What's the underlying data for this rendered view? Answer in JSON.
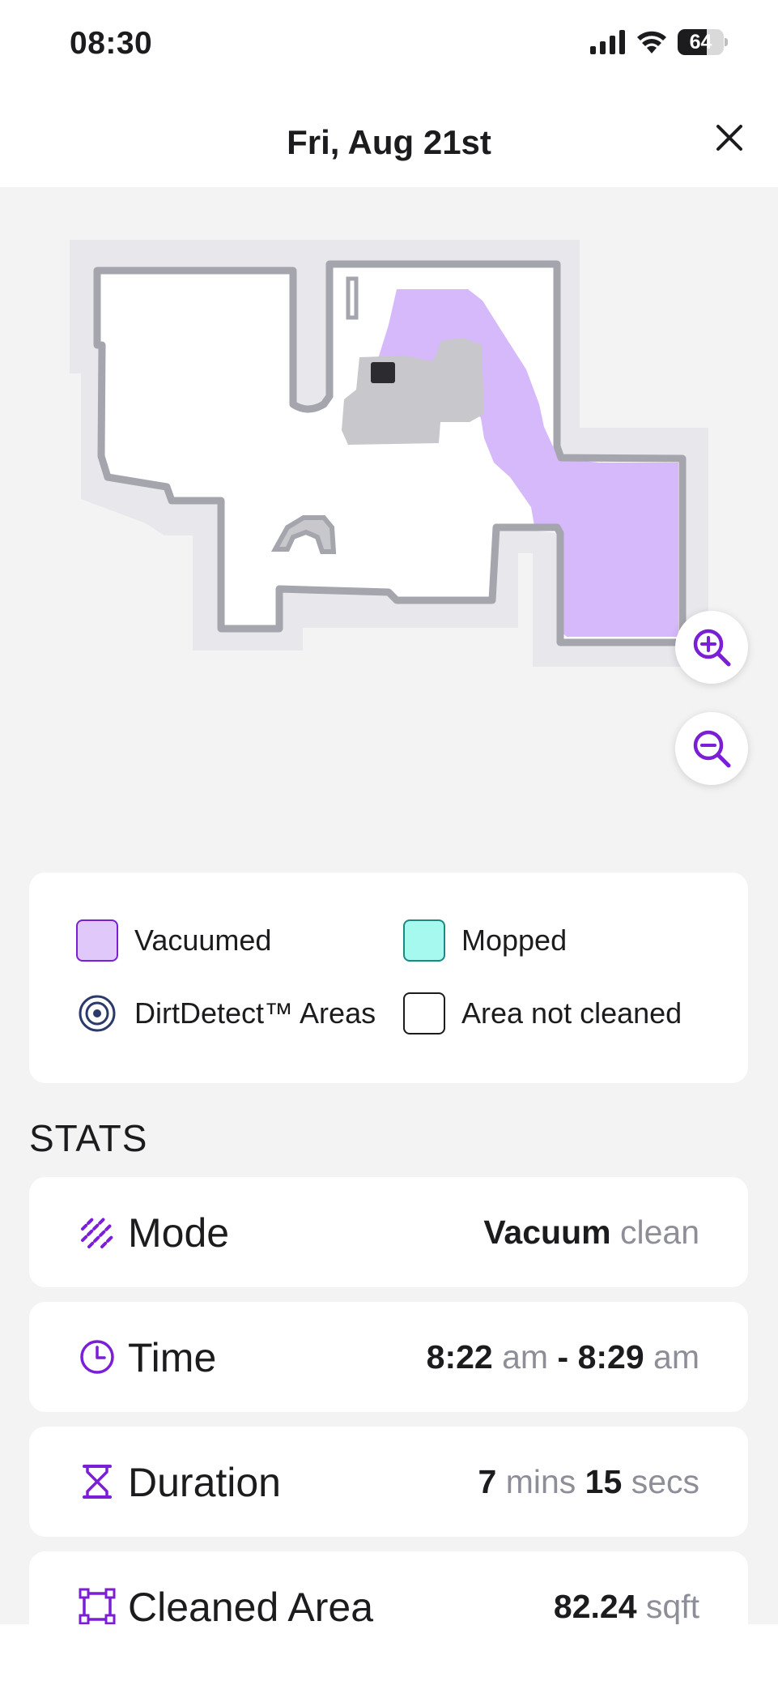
{
  "status_bar": {
    "time": "08:30",
    "battery": "64",
    "battery_level": 0.64
  },
  "header": {
    "title": "Fri, Aug 21st"
  },
  "map": {
    "vacuumed_color": "#d6b9fb",
    "wall_color": "#a5a5ad",
    "obstacle_color": "#c8c8cc",
    "dock_color": "#2b2b30"
  },
  "legend": {
    "vacuumed": "Vacuumed",
    "mopped": "Mopped",
    "dirtdetect": "DirtDetect™ Areas",
    "not_cleaned": "Area not cleaned",
    "vacuumed_color": "#e0c8fb",
    "mopped_color": "#a6f9ee"
  },
  "stats": {
    "title": "STATS",
    "mode": {
      "label": "Mode",
      "value_bold": "Vacuum",
      "value_light": "clean",
      "icon": "mode-icon"
    },
    "time": {
      "label": "Time",
      "start": "8:22",
      "start_unit": "am",
      "separator": "-",
      "end": "8:29",
      "end_unit": "am",
      "icon": "clock-icon"
    },
    "duration": {
      "label": "Duration",
      "mins": "7",
      "mins_unit": "mins",
      "secs": "15",
      "secs_unit": "secs",
      "icon": "hourglass-icon"
    },
    "area": {
      "label": "Cleaned Area",
      "value": "82.24",
      "unit": "sqft",
      "icon": "area-icon"
    }
  },
  "accent_color": "#7a1fd6"
}
